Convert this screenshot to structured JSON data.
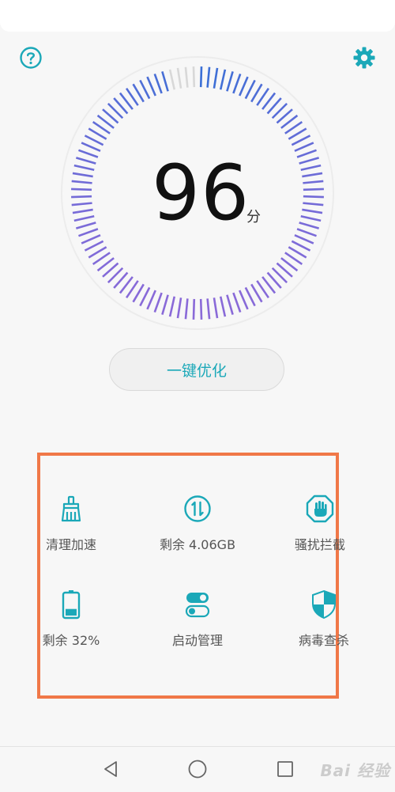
{
  "colors": {
    "accent": "#1ba8b8",
    "gauge_blue": "#3a6fd6",
    "gauge_purple": "#8a6ad8",
    "gauge_inactive": "#d8d8d8",
    "highlight_box": "#f07848"
  },
  "header": {
    "help_icon": "question-circle-icon",
    "settings_icon": "gear-icon"
  },
  "score": {
    "value": "96",
    "unit": "分",
    "gauge_fill_fraction": 0.96
  },
  "optimize_button": {
    "label": "一键优化"
  },
  "tools": [
    {
      "icon": "broom-icon",
      "label": "清理加速"
    },
    {
      "icon": "memory-icon",
      "label": "剩余 4.06GB"
    },
    {
      "icon": "hand-block-icon",
      "label": "骚扰拦截"
    },
    {
      "icon": "battery-icon",
      "label": "剩余 32%",
      "battery_level": 0.32
    },
    {
      "icon": "toggle-switch-icon",
      "label": "启动管理"
    },
    {
      "icon": "shield-icon",
      "label": "病毒查杀"
    }
  ],
  "navbar": {
    "back_icon": "back-triangle-icon",
    "home_icon": "home-circle-icon",
    "recent_icon": "recent-square-icon"
  },
  "watermark": {
    "text": "Bai 经验"
  }
}
